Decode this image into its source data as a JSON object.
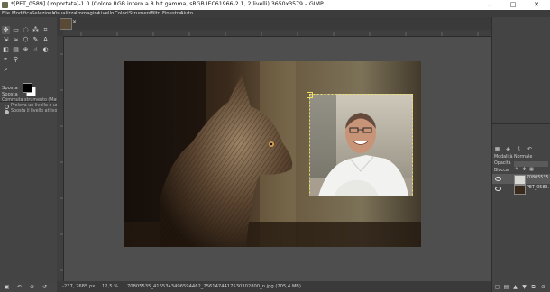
{
  "window": {
    "title": "*[PET_0589] (importata)-1.0 (Colore RGB intero a 8 bit gamma, sRGB IEC61966-2.1, 2 livelli) 3650x3579 – GIMP",
    "minimize": "–",
    "maximize": "□",
    "close": "✕"
  },
  "menubar": [
    "File",
    "Modifica",
    "Seleziona",
    "Visualizza",
    "Immagine",
    "Livello",
    "Colori",
    "Strumenti",
    "Filtri",
    "Finestre",
    "Aiuto"
  ],
  "toolbox": {
    "tool_icons": [
      "move-tool-icon",
      "rect-select-icon",
      "lasso-icon",
      "fuzzy-select-icon",
      "crop-icon",
      "transform-icon",
      "warp-icon",
      "cage-icon",
      "paint-icon",
      "text-icon",
      "bucket-icon",
      "gradient-icon",
      "clone-icon",
      "smudge-icon",
      "dodge-icon",
      "path-icon",
      "picker-icon",
      "zoom-icon"
    ],
    "options_tab1": "Sposta",
    "options_tab2": "Sposta",
    "options_row1": "Commuta strumento (Maiusc)",
    "options_row2": "Preleva un livello o una guida",
    "options_row3": "Sposta il livello attivo"
  },
  "tab": {
    "close": "✕"
  },
  "status": {
    "coords": "-237, 2685",
    "unit": "px",
    "zoom": "12,5 %",
    "filename": "70805535_4165343496594462_2561474417530302800_n.jpg (205,4 MB)"
  },
  "dock": {
    "mode_label": "Modalità",
    "mode_value": "Normale",
    "opacity_label": "Opacità",
    "lock_label": "Blocca:",
    "layers": [
      {
        "name": "70805535",
        "visible": true,
        "active": true
      },
      {
        "name": "PET_0589.",
        "visible": true,
        "active": false
      }
    ]
  },
  "colors": {
    "title_bg": "#ffffff",
    "panel_bg": "#444444",
    "canvas_bg": "#4e4e4e",
    "selection_dash": "#f0e060"
  }
}
